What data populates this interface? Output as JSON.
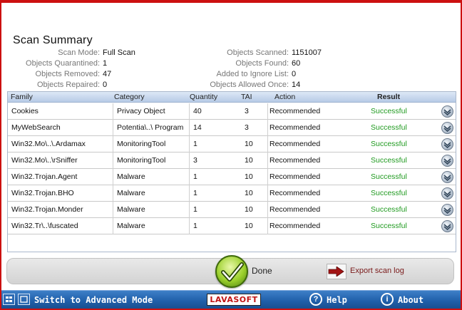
{
  "title": "Scan Summary",
  "stats_left": [
    {
      "label": "Scan Mode:",
      "value": "Full Scan"
    },
    {
      "label": "Objects Quarantined:",
      "value": "1"
    },
    {
      "label": "Objects Removed:",
      "value": "47"
    },
    {
      "label": "Objects Repaired:",
      "value": "0"
    }
  ],
  "stats_right": [
    {
      "label": "Objects Scanned:",
      "value": "1151007"
    },
    {
      "label": "Objects Found:",
      "value": "60"
    },
    {
      "label": "Added to Ignore List:",
      "value": "0"
    },
    {
      "label": "Objects Allowed Once:",
      "value": "14"
    }
  ],
  "table": {
    "columns": [
      "Family",
      "Category",
      "Quantity",
      "TAI",
      "Action",
      "Result"
    ],
    "rows": [
      {
        "family": "Cookies",
        "category": "Privacy Object",
        "quantity": "40",
        "tai": "3",
        "action": "Recommended",
        "result": "Successful"
      },
      {
        "family": "MyWebSearch",
        "category": "Potentia\\..\\ Program",
        "quantity": "14",
        "tai": "3",
        "action": "Recommended",
        "result": "Successful"
      },
      {
        "family": "Win32.Mo\\..\\.Ardamax",
        "category": "MonitoringTool",
        "quantity": "1",
        "tai": "10",
        "action": "Recommended",
        "result": "Successful"
      },
      {
        "family": "Win32.Mo\\..\\rSniffer",
        "category": "MonitoringTool",
        "quantity": "3",
        "tai": "10",
        "action": "Recommended",
        "result": "Successful"
      },
      {
        "family": "Win32.Trojan.Agent",
        "category": "Malware",
        "quantity": "1",
        "tai": "10",
        "action": "Recommended",
        "result": "Successful"
      },
      {
        "family": "Win32.Trojan.BHO",
        "category": "Malware",
        "quantity": "1",
        "tai": "10",
        "action": "Recommended",
        "result": "Successful"
      },
      {
        "family": "Win32.Trojan.Monder",
        "category": "Malware",
        "quantity": "1",
        "tai": "10",
        "action": "Recommended",
        "result": "Successful"
      },
      {
        "family": "Win32.Tr\\..\\fuscated",
        "category": "Malware",
        "quantity": "1",
        "tai": "10",
        "action": "Recommended",
        "result": "Successful"
      }
    ]
  },
  "actions": {
    "done_label": "Done",
    "export_label": "Export scan log"
  },
  "footer": {
    "switch_label": "Switch to Advanced Mode",
    "logo_text": "LAVASOFT",
    "help_label": "Help",
    "about_label": "About"
  },
  "colors": {
    "frame": "#cc1010",
    "success": "#1f9a1f",
    "bottom_bar": "#1f5ea8"
  },
  "icons": [
    "expand-row-icon",
    "checkmark-icon",
    "export-arrow-icon",
    "grid-view-icon",
    "single-view-icon",
    "help-icon",
    "info-icon"
  ]
}
